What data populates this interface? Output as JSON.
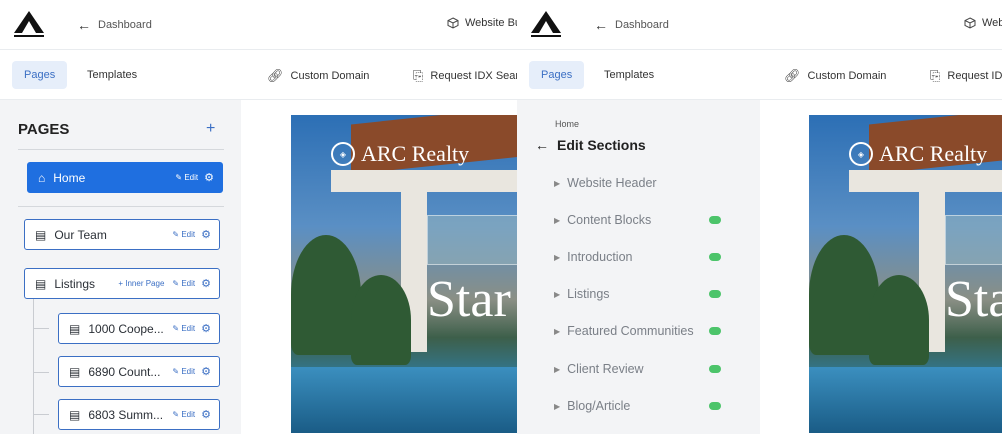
{
  "header": {
    "back_label": "Dashboard",
    "website_builder_label": "Website Bui",
    "website_builder_label_b": "Web"
  },
  "subnav": {
    "tabs": [
      "Pages",
      "Templates"
    ],
    "custom_domain": "Custom Domain",
    "request_idx": "Request IDX Search",
    "request_idx_b": "Request IDX"
  },
  "pages_panel": {
    "title": "PAGES",
    "add_symbol": "+",
    "edit_label": "Edit",
    "inner_page_label": "Inner Page",
    "items": [
      {
        "label": "Home"
      },
      {
        "label": "Our Team"
      },
      {
        "label": "Listings"
      },
      {
        "label": "1000 Coope..."
      },
      {
        "label": "6890 Count..."
      },
      {
        "label": "6803 Summ..."
      }
    ]
  },
  "preview": {
    "brand": "ARC Realty",
    "headline_a": "Star",
    "headline_b": "Sta"
  },
  "sections_panel": {
    "breadcrumb": "Home",
    "title": "Edit Sections",
    "sections": [
      {
        "label": "Website Header",
        "enabled": null
      },
      {
        "label": "Content Blocks",
        "enabled": true
      },
      {
        "label": "Introduction",
        "enabled": true
      },
      {
        "label": "Listings",
        "enabled": true
      },
      {
        "label": "Featured Communities",
        "enabled": true
      },
      {
        "label": "Client Review",
        "enabled": true
      },
      {
        "label": "Blog/Article",
        "enabled": true
      }
    ]
  },
  "colors": {
    "accent": "#1f6fe0",
    "toggle_on": "#4cc46a",
    "panel_bg": "#f3f4f6"
  }
}
